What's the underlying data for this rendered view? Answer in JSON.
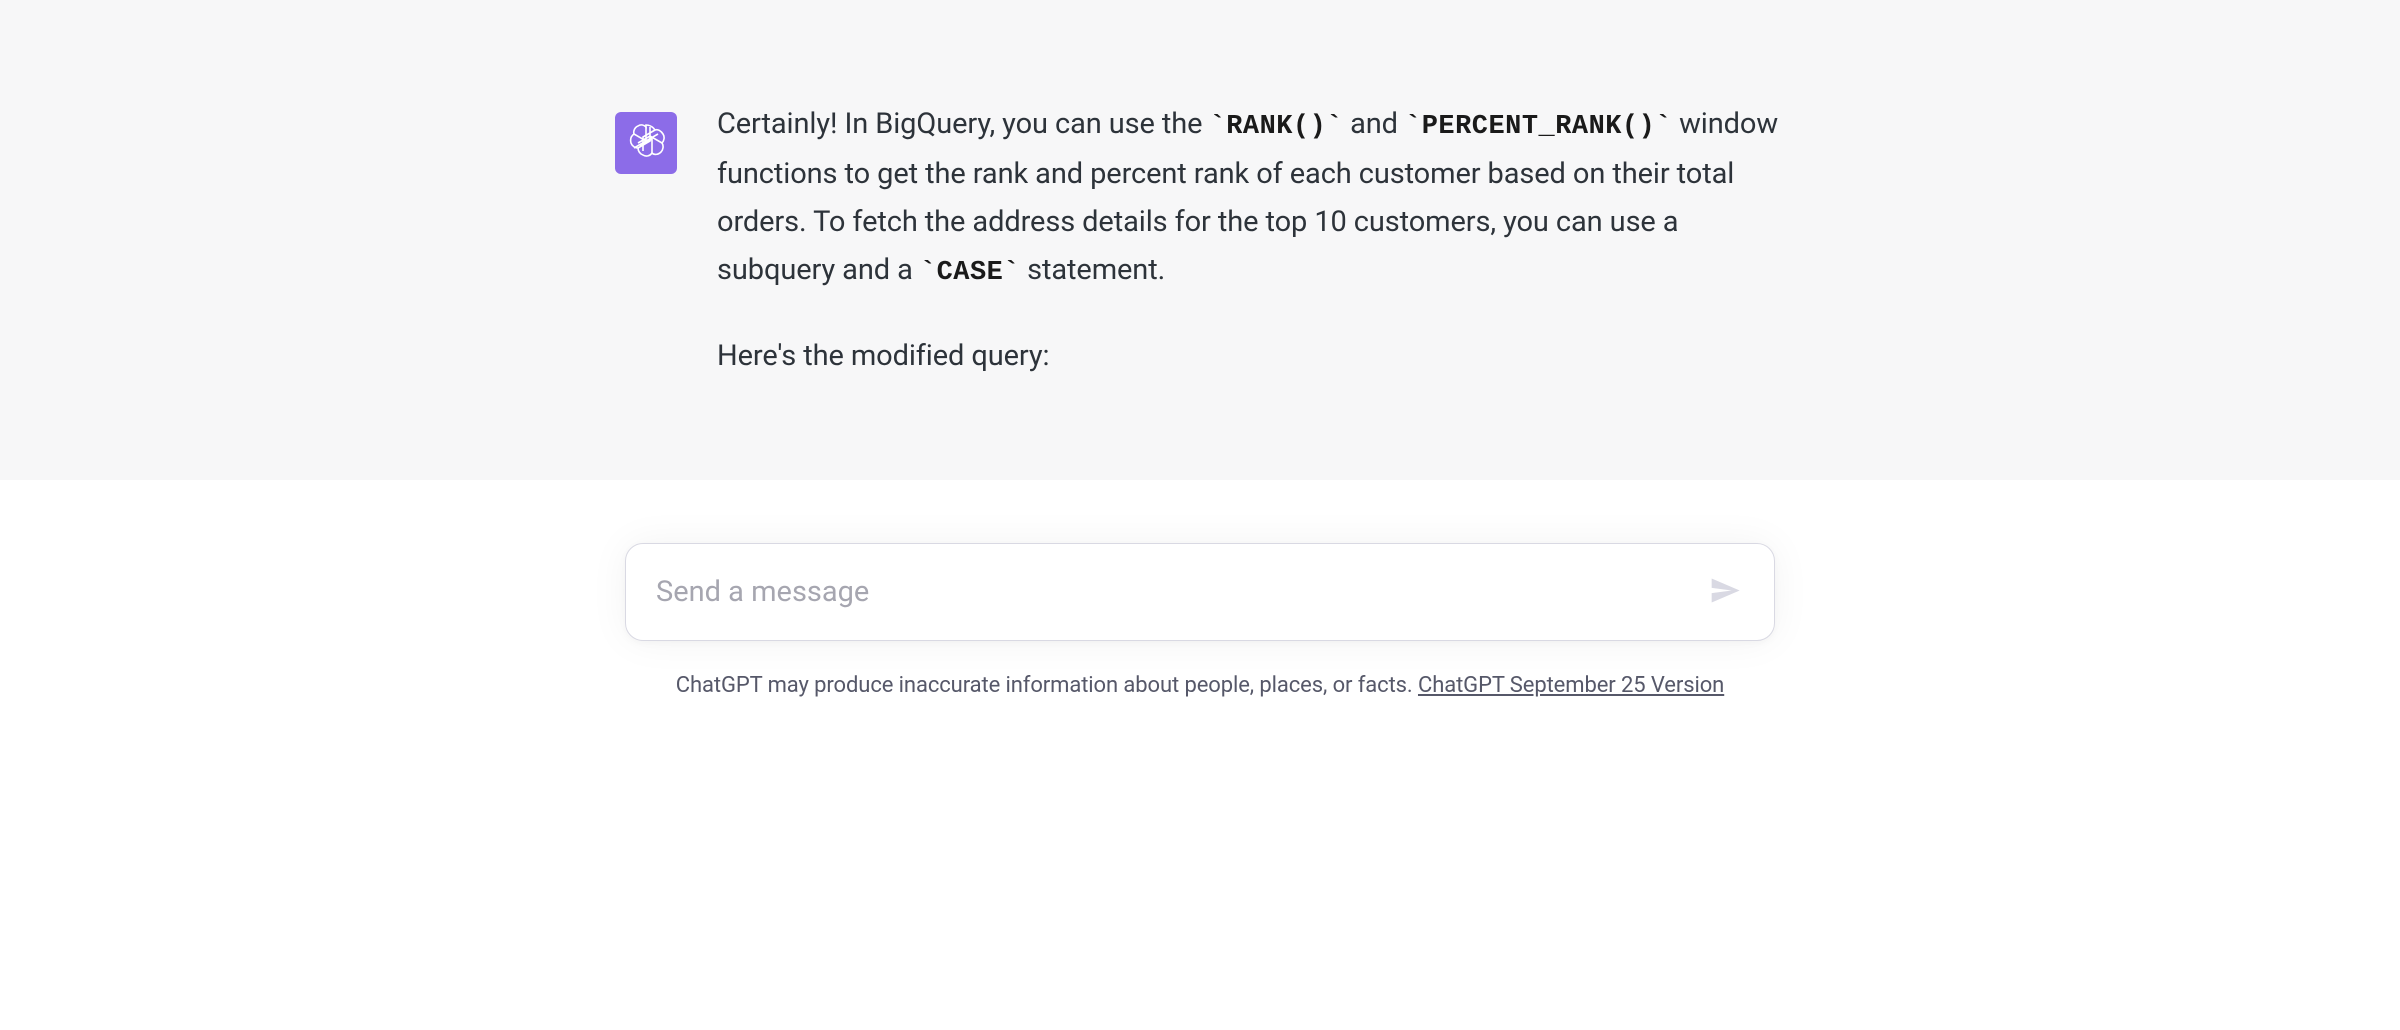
{
  "message": {
    "paragraph1": {
      "part1": "Certainly! In BigQuery, you can use the ",
      "code1": "`RANK()`",
      "part2": " and ",
      "code2": "`PERCENT_RANK()`",
      "part3": " window functions to get the rank and percent rank of each customer based on their total orders. To fetch the address details for the top 10 customers, you can use a subquery and a ",
      "code3": "`CASE`",
      "part4": " statement."
    },
    "paragraph2": "Here's the modified query:"
  },
  "input": {
    "placeholder": "Send a message"
  },
  "disclaimer": {
    "text": "ChatGPT may produce inaccurate information about people, places, or facts. ",
    "link_text": "ChatGPT September 25 Version"
  }
}
